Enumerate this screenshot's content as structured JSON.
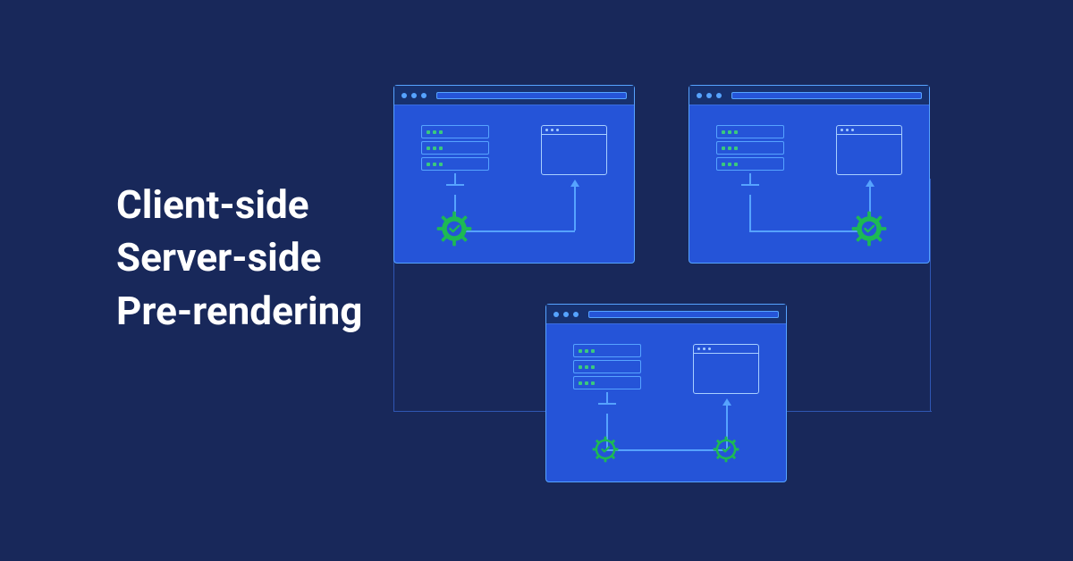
{
  "heading": {
    "line1": "Client-side",
    "line2": "Server-side",
    "line3": "Pre-rendering"
  },
  "colors": {
    "background": "#18285a",
    "window_fill": "#2554d8",
    "window_stroke": "#56a3ff",
    "accent_green": "#1db954",
    "accent_green_dark": "#0e7a3a",
    "text": "#ffffff"
  },
  "diagram": {
    "windows": [
      {
        "id": "client-side",
        "gear_size": "big",
        "gear_position": "server",
        "gear_color": "green"
      },
      {
        "id": "server-side",
        "gear_size": "big",
        "gear_position": "browser",
        "gear_color": "green"
      },
      {
        "id": "pre-rendering",
        "gear_size": "small",
        "gear_positions": [
          "server",
          "browser"
        ],
        "gear_color": "green-outline"
      }
    ]
  }
}
